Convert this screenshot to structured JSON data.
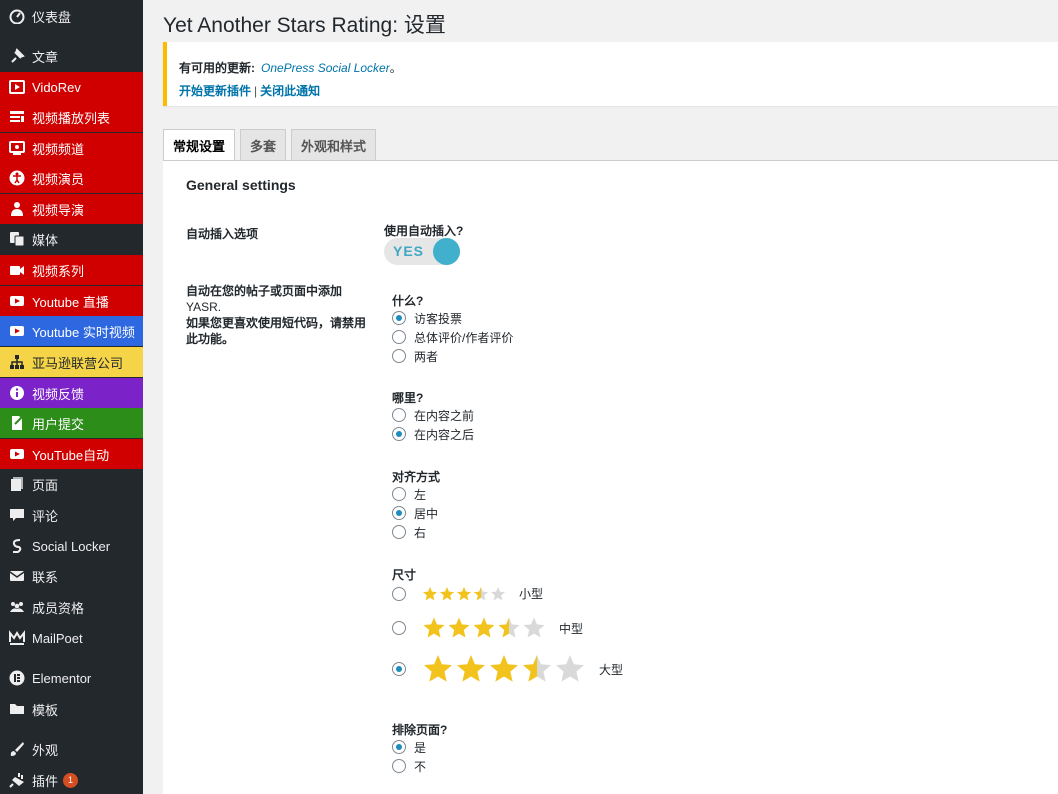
{
  "colors": {
    "sidebar_bg": "#23282d",
    "accent_red": "#d00000",
    "accent_blue": "#2e68e0",
    "accent_yellow": "#f5d547",
    "accent_purple": "#7b22c9",
    "accent_green": "#2c8d18",
    "star_gold": "#f2c31c",
    "star_grey": "#d9d9d9",
    "toggle": "#40b0cc"
  },
  "sidebar": {
    "items": [
      {
        "label": "仪表盘",
        "icon": "dashboard-icon",
        "bg": "#23282d",
        "color": "#eee"
      },
      {
        "label": "文章",
        "icon": "pin-icon",
        "bg": "#23282d",
        "color": "#eee"
      },
      {
        "label": "VidoRev",
        "icon": "video-icon",
        "bg": "#d00000",
        "color": "#fff"
      },
      {
        "label": "视频播放列表",
        "icon": "playlist-icon",
        "bg": "#d00000",
        "color": "#fff"
      },
      {
        "label": "视频频道",
        "icon": "channel-icon",
        "bg": "#d00000",
        "color": "#fff"
      },
      {
        "label": "视频演员",
        "icon": "accessibility-icon",
        "bg": "#d00000",
        "color": "#fff"
      },
      {
        "label": "视频导演",
        "icon": "director-icon",
        "bg": "#d00000",
        "color": "#fff"
      },
      {
        "label": "媒体",
        "icon": "media-icon",
        "bg": "#23282d",
        "color": "#eee"
      },
      {
        "label": "视频系列",
        "icon": "camera-icon",
        "bg": "#d00000",
        "color": "#fff"
      },
      {
        "label": "Youtube 直播",
        "icon": "youtube-icon",
        "bg": "#d00000",
        "color": "#fff"
      },
      {
        "label": "Youtube 实时视频",
        "icon": "youtube-icon",
        "bg": "#2e68e0",
        "color": "#fff"
      },
      {
        "label": "亚马逊联营公司",
        "icon": "sitemap-icon",
        "bg": "#f5d547",
        "color": "#23282d"
      },
      {
        "label": "视频反馈",
        "icon": "info-icon",
        "bg": "#7b22c9",
        "color": "#fff"
      },
      {
        "label": "用户提交",
        "icon": "document-icon",
        "bg": "#2c8d18",
        "color": "#fff"
      },
      {
        "label": "YouTube自动",
        "icon": "youtube-icon",
        "bg": "#d00000",
        "color": "#fff"
      },
      {
        "label": "页面",
        "icon": "pages-icon",
        "bg": "#23282d",
        "color": "#eee"
      },
      {
        "label": "评论",
        "icon": "comment-icon",
        "bg": "#23282d",
        "color": "#eee"
      },
      {
        "label": "Social Locker",
        "icon": "social-locker-icon",
        "bg": "#23282d",
        "color": "#eee"
      },
      {
        "label": "联系",
        "icon": "mail-icon",
        "bg": "#23282d",
        "color": "#eee"
      },
      {
        "label": "成员资格",
        "icon": "groups-icon",
        "bg": "#23282d",
        "color": "#eee"
      },
      {
        "label": "MailPoet",
        "icon": "mailpoet-icon",
        "bg": "#23282d",
        "color": "#eee"
      },
      {
        "label": "Elementor",
        "icon": "elementor-icon",
        "bg": "#23282d",
        "color": "#eee"
      },
      {
        "label": "模板",
        "icon": "folder-icon",
        "bg": "#23282d",
        "color": "#eee"
      },
      {
        "label": "外观",
        "icon": "brush-icon",
        "bg": "#23282d",
        "color": "#eee"
      },
      {
        "label": "插件",
        "icon": "plugin-icon",
        "bg": "#23282d",
        "color": "#eee",
        "badge": "1"
      }
    ]
  },
  "page": {
    "title": "Yet Another Stars Rating: 设置"
  },
  "notice": {
    "prefix": "有可用的更新:",
    "plugin": "OnePress Social Locker",
    "suffix": "。",
    "start_update": "开始更新插件",
    "separator": "|",
    "dismiss": "关闭此通知"
  },
  "tabs": [
    {
      "label": "常规设置",
      "active": true
    },
    {
      "label": "多套",
      "active": false
    },
    {
      "label": "外观和样式",
      "active": false
    }
  ],
  "settings": {
    "section_title": "General settings",
    "auto_insert_label": "自动插入选项",
    "auto_insert_question": "使用自动插入?",
    "toggle_text": "YES",
    "desc_line1": "自动在您的帖子或页面中添加",
    "desc_line2": "YASR.",
    "desc_line3": "如果您更喜欢使用短代码，请禁用此功能。",
    "what": {
      "title": "什么?",
      "options": [
        "访客投票",
        "总体评价/作者评价",
        "两者"
      ],
      "selected": 0
    },
    "where": {
      "title": "哪里?",
      "options": [
        "在内容之前",
        "在内容之后"
      ],
      "selected": 1
    },
    "align": {
      "title": "对齐方式",
      "options": [
        "左",
        "居中",
        "右"
      ],
      "selected": 1
    },
    "size": {
      "title": "尺寸",
      "options": [
        {
          "label": "小型",
          "rating": 3.5
        },
        {
          "label": "中型",
          "rating": 3.5
        },
        {
          "label": "大型",
          "rating": 3.5
        }
      ],
      "selected": 2
    },
    "exclude": {
      "title": "排除页面?",
      "options": [
        "是",
        "不"
      ],
      "selected": 0
    }
  }
}
